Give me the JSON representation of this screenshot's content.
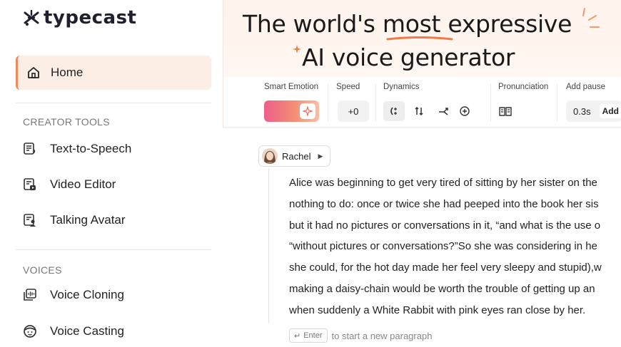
{
  "app": {
    "logo_text": "typecast",
    "accent": "#f08a5d"
  },
  "sidebar": {
    "home_label": "Home",
    "creator_tools_title": "CREATOR TOOLS",
    "creator_items": [
      {
        "label": "Text-to-Speech",
        "icon": "text-to-speech-icon"
      },
      {
        "label": "Video Editor",
        "icon": "video-editor-icon"
      },
      {
        "label": "Talking Avatar",
        "icon": "talking-avatar-icon"
      }
    ],
    "voices_title": "VOICES",
    "voice_items": [
      {
        "label": "Voice Cloning",
        "icon": "voice-cloning-icon"
      },
      {
        "label": "Voice Casting",
        "icon": "voice-casting-icon"
      }
    ]
  },
  "hero": {
    "line1_pre": "The world's ",
    "line1_highlight": "most",
    "line1_post": " expressive",
    "line2": "AI voice generator"
  },
  "toolbar": {
    "smart_emotion_label": "Smart Emotion",
    "speed_label": "Speed",
    "speed_value": "+0",
    "dynamics_label": "Dynamics",
    "pronunciation_label": "Pronunciation",
    "add_pause_label": "Add pause",
    "pause_value": "0.3s",
    "add_button": "Add"
  },
  "editor": {
    "speaker_name": "Rachel",
    "lines": [
      "Alice was beginning to get very tired of sitting by her sister on the",
      "nothing to do: once or twice she had peeped into the book her sis",
      "but it had no pictures or conversations in it, “and what is the use o",
      "“without pictures or conversations?”So she was considering in he",
      "she could, for the hot day made her feel very sleepy and stupid),w",
      " making a daisy-chain would be worth the trouble of getting up an",
      "when suddenly a White Rabbit with pink eyes ran close by her."
    ],
    "enter_key": "Enter",
    "enter_hint": "to start a new paragraph"
  }
}
